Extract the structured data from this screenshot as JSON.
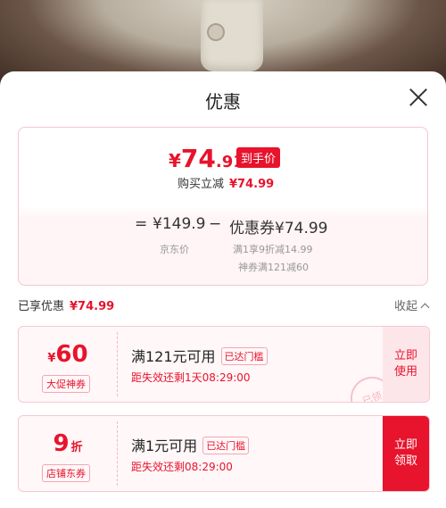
{
  "sheet": {
    "title": "优惠"
  },
  "summary": {
    "price_symbol": "¥",
    "price_int": "74",
    "price_dec": ".91",
    "badge": "到手价",
    "reduce_label": "购买立减",
    "reduce_amount": "¥74.99",
    "eq": "=",
    "orig_price": "¥149.9",
    "minus": "−",
    "coupon_total": "优惠券¥74.99",
    "orig_label": "京东价",
    "coupon_line1": "满1享9折减14.99",
    "coupon_line2": "神券满121减60"
  },
  "enjoyed": {
    "label": "已享优惠",
    "amount": "¥74.99"
  },
  "collapse_label": "收起",
  "coupons": [
    {
      "value_symbol": "¥",
      "value": "60",
      "tag": "大促神券",
      "condition": "满121元可用",
      "met": "已达门槛",
      "expire": "距失效还剩1天08:29:00",
      "action_line1": "立即",
      "action_line2": "使用",
      "stamp": "已领"
    },
    {
      "value": "9",
      "unit": "折",
      "tag": "店铺东券",
      "condition": "满1元可用",
      "met": "已达门槛",
      "expire": "距失效还剩08:29:00",
      "action_line1": "立即",
      "action_line2": "领取"
    }
  ],
  "colors": {
    "accent": "#e8132c",
    "coupon_bg": "#fff7f8",
    "soft_action": "#fde6ea"
  }
}
